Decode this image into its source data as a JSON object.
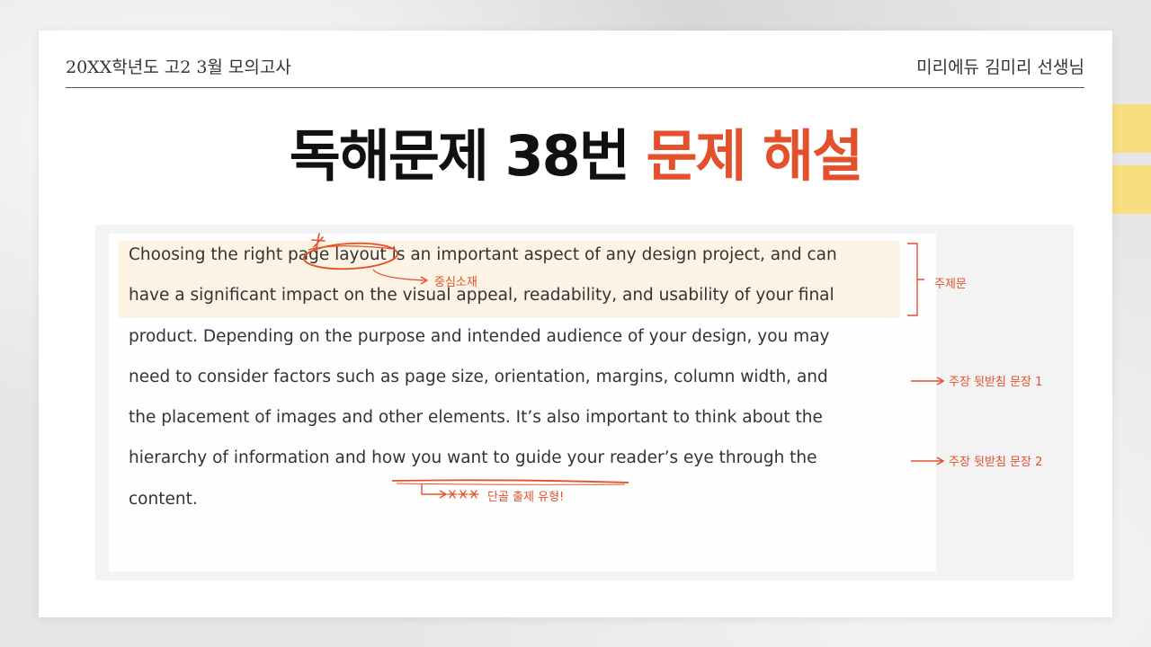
{
  "header": {
    "left_text": "20XX학년도 고2 3월 모의고사",
    "right_text": "미리에듀 김미리 선생님"
  },
  "title": {
    "main": "독해문제 38번 ",
    "accent": "문제 해설"
  },
  "passage": {
    "lines": [
      "Choosing the right page layout is an important aspect of any design project, and can",
      "have a significant impact on the visual appeal, readability, and usability of your final",
      "product. Depending on the purpose and intended audience of your design, you may",
      "need to consider factors such as page size, orientation, margins, column width, and",
      "the placement of images and other elements. It’s also important to think about the",
      "hierarchy of information and how you want to guide your reader’s eye through the",
      "content."
    ]
  },
  "annotations": {
    "central_topic": "중심소재",
    "thesis": "주제문",
    "support_1": "주장 뒷받침 문장 1",
    "support_2": "주장 뒷받침 문장 2",
    "frequent": "단골 출제 유형!"
  },
  "colors": {
    "accent": "#e2502c",
    "highlight": "#fdf2e1",
    "yellow_tab": "#f8de7e"
  }
}
